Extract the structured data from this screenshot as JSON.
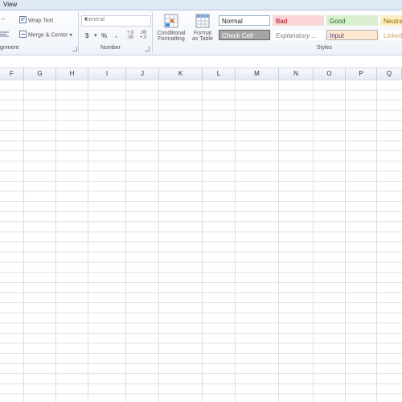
{
  "menu": {
    "view_tab": "View"
  },
  "ribbon": {
    "alignment": {
      "arrow_glyph": "→",
      "wrap_text": "Wrap Text",
      "merge_center": "Merge & Center",
      "group_label": "gnment"
    },
    "number": {
      "format_value": "General",
      "currency": "$",
      "percent": "%",
      "comma": ",",
      "increase_decimal": "+.0 .00",
      "decrease_decimal": ".00 +.0",
      "group_label": "Number"
    },
    "conditional_formatting": {
      "line1": "Conditional",
      "line2": "Formatting"
    },
    "format_as_table": {
      "line1": "Format",
      "line2": "as Table"
    },
    "styles": {
      "group_label": "Styles",
      "cells": [
        {
          "label": "Normal",
          "bg": "#ffffff",
          "color": "#222222",
          "border": "#9ab0cc"
        },
        {
          "label": "Bad",
          "bg": "#fbd6d8",
          "color": "#9c0006",
          "border": "#fbd6d8"
        },
        {
          "label": "Good",
          "bg": "#d8eecf",
          "color": "#2a6a2a",
          "border": "#d8eecf"
        },
        {
          "label": "Neutra",
          "bg": "#fdefc4",
          "color": "#8a6a00",
          "border": "#fdefc4"
        },
        {
          "label": "Check Cell",
          "bg": "#a5a5a5",
          "color": "#ffffff",
          "border": "#666666"
        },
        {
          "label": "Explanatory ...",
          "bg": "#ffffff",
          "color": "#7f7f7f",
          "border": "#ffffff"
        },
        {
          "label": "Input",
          "bg": "#ffe7d2",
          "color": "#3f3f76",
          "border": "#b3b3b3"
        },
        {
          "label": "Linked",
          "bg": "#ffffff",
          "color": "#d6a06a",
          "border": "#ffffff"
        }
      ]
    }
  },
  "columns": [
    "F",
    "G",
    "H",
    "I",
    "J",
    "K",
    "L",
    "M",
    "N",
    "O",
    "P",
    "Q"
  ]
}
